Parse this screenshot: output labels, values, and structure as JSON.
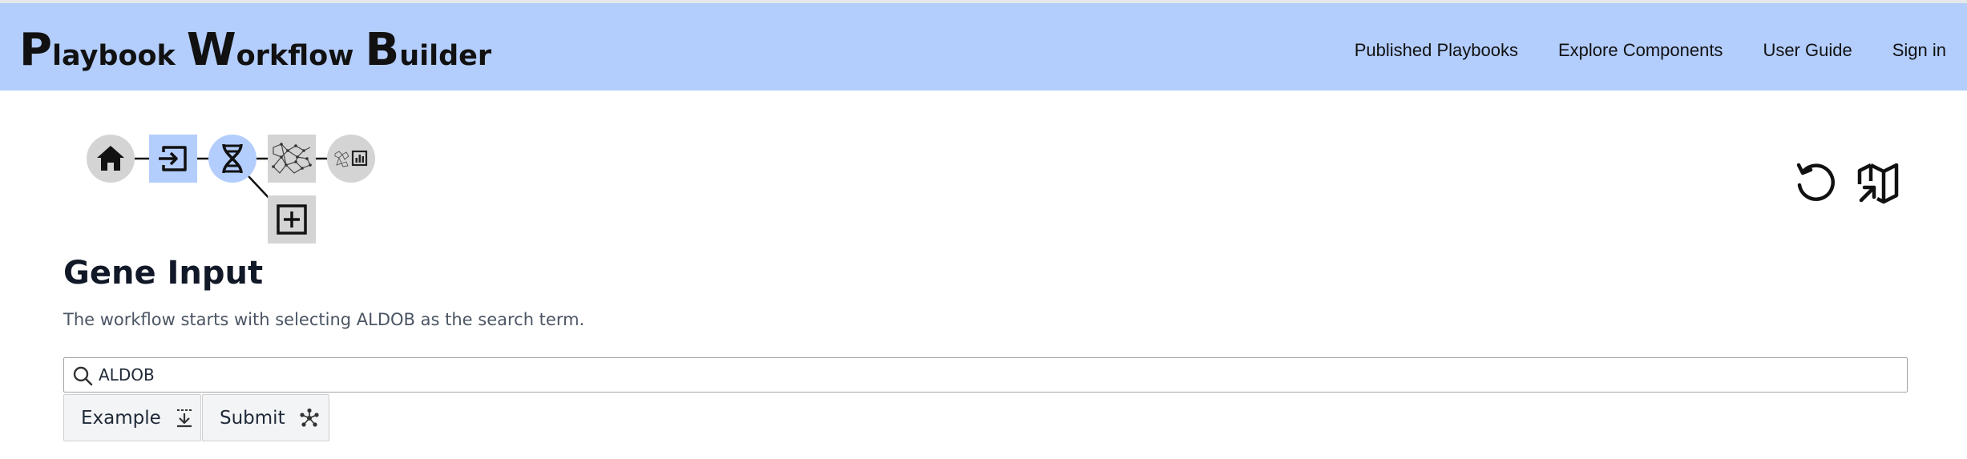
{
  "header": {
    "brand": [
      {
        "cap": "P",
        "rest": "laybook"
      },
      {
        "cap": "W",
        "rest": "orkflow"
      },
      {
        "cap": "B",
        "rest": "uilder"
      }
    ],
    "nav": [
      {
        "label": "Published Playbooks"
      },
      {
        "label": "Explore Components"
      },
      {
        "label": "User Guide"
      },
      {
        "label": "Sign in"
      }
    ],
    "background": "#b3cdfd"
  },
  "breadcrumb": {
    "nodes": [
      {
        "name": "home",
        "icon": "home-icon",
        "shape": "circle",
        "color": "#d4d4d4"
      },
      {
        "name": "input",
        "icon": "input-icon",
        "shape": "square",
        "color": "#b3cdfd"
      },
      {
        "name": "gene",
        "icon": "dna-icon",
        "shape": "circle",
        "color": "#b3cdfd"
      },
      {
        "name": "network",
        "icon": "network-icon",
        "shape": "square",
        "color": "#d4d4d4"
      },
      {
        "name": "report",
        "icon": "report-icon",
        "shape": "circle",
        "color": "#d4d4d4"
      },
      {
        "name": "add",
        "icon": "add-icon",
        "shape": "square",
        "color": "#d4d4d4"
      }
    ]
  },
  "toolbar": {
    "restart_icon": "restart-icon",
    "map_icon": "map-icon"
  },
  "main": {
    "title": "Gene Input",
    "description": "The workflow starts with selecting ALDOB as the search term.",
    "search": {
      "value": "ALDOB",
      "icon": "search-icon"
    },
    "buttons": {
      "example": {
        "label": "Example",
        "icon": "download-icon"
      },
      "submit": {
        "label": "Submit",
        "icon": "submit-icon"
      }
    }
  }
}
